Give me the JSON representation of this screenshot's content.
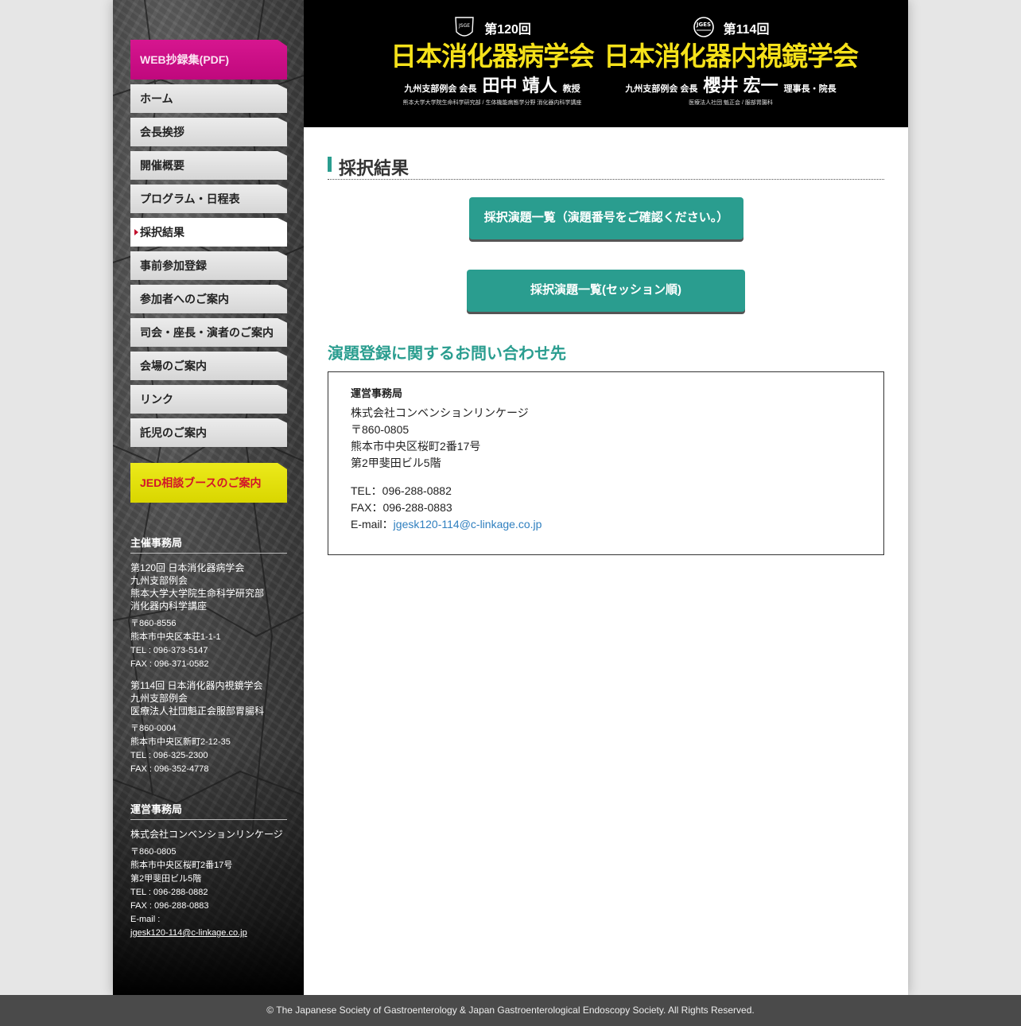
{
  "header": {
    "left": {
      "logo_text": "JSGE",
      "number": "第120回",
      "name": "日本消化器病学会",
      "president_prefix": "九州支部例会 会長",
      "president_name": "田中 靖人",
      "president_title": "教授",
      "affiliation": "熊本大学大学院生命科学研究部 / 生体機能病態学分野 消化器内科学講座"
    },
    "right": {
      "logo_text": "JGES",
      "number": "第114回",
      "name": "日本消化器内視鏡学会",
      "president_prefix": "九州支部例会 会長",
      "president_name": "櫻井 宏一",
      "president_title": "理事長・院長",
      "affiliation": "医療法人社団 魁正会 / 服部胃腸科"
    }
  },
  "nav": {
    "pdf": "WEB抄録集(PDF)",
    "items": [
      "ホーム",
      "会長挨拶",
      "開催概要",
      "プログラム・日程表",
      "採択結果",
      "事前参加登録",
      "参加者へのご案内",
      "司会・座長・演者のご案内",
      "会場のご案内",
      "リンク",
      "託児のご案内"
    ],
    "active_index": 4,
    "jed": "JED相談ブースのご案内"
  },
  "sidebar": {
    "host": {
      "heading": "主催事務局",
      "org1_lines": [
        "第120回 日本消化器病学会",
        "九州支部例会",
        "熊本大学大学院生命科学研究部",
        "消化器内科学講座"
      ],
      "org1_contact": [
        "〒860-8556",
        "熊本市中央区本荘1-1-1",
        "TEL : 096-373-5147",
        "FAX : 096-371-0582"
      ],
      "org2_lines": [
        "第114回 日本消化器内視鏡学会",
        "九州支部例会",
        "医療法人社団魁正会服部胃腸科"
      ],
      "org2_contact": [
        "〒860-0004",
        "熊本市中央区新町2-12-35",
        "TEL : 096-325-2300",
        "FAX : 096-352-4778"
      ]
    },
    "ops": {
      "heading": "運営事務局",
      "company": "株式会社コンベンションリンケージ",
      "contact": [
        "〒860-0805",
        "熊本市中央区桜町2番17号",
        "第2甲斐田ビル5階",
        "TEL : 096-288-0882",
        "FAX : 096-288-0883",
        "E-mail :"
      ],
      "email": "jgesk120-114@c-linkage.co.jp"
    }
  },
  "main": {
    "title": "採択結果",
    "button1": "採択演題一覧（演題番号をご確認ください。）",
    "button2": "採択演題一覧(セッション順)",
    "contact_heading": "演題登録に関するお問い合わせ先",
    "contact": {
      "title": "運営事務局",
      "company": "株式会社コンベンションリンケージ",
      "postal": "〒860-0805",
      "address1": "熊本市中央区桜町2番17号",
      "address2": "第2甲斐田ビル5階",
      "tel": "TEL：096-288-0882",
      "fax": "FAX：096-288-0883",
      "email_label": "E-mail：",
      "email": "jgesk120-114@c-linkage.co.jp"
    }
  },
  "footer": {
    "copyright": "© The Japanese Society of Gastroenterology & Japan Gastroenterological Endoscopy Society. All Rights Reserved."
  },
  "colors": {
    "teal": "#2a9d8f",
    "magenta": "#c0087d",
    "yellow": "#dcd900",
    "header_yellow": "#f5e11a"
  }
}
